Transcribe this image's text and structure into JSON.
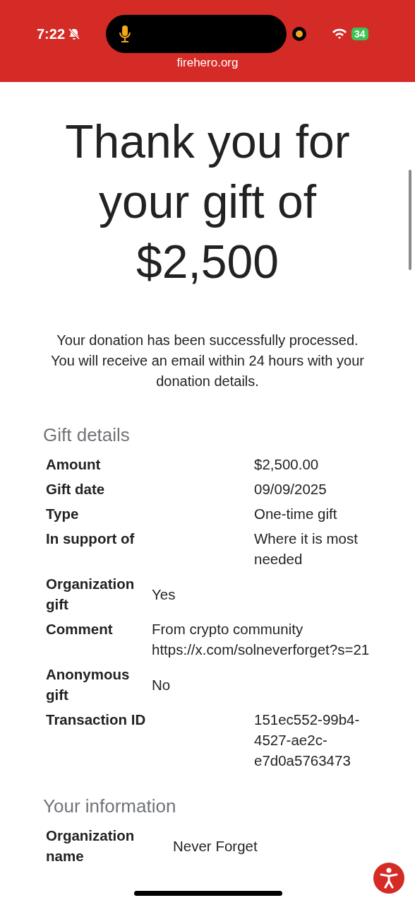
{
  "status_bar": {
    "time": "7:22",
    "battery": "34",
    "url": "firehero.org"
  },
  "heading": "Thank you for your gift of $2,500",
  "message": "Your donation has been successfully processed. You will receive an email within 24 hours with your donation details.",
  "sections": [
    {
      "title": "Gift details",
      "rows": [
        {
          "kind": "wide",
          "label": "Amount",
          "value": "$2,500.00"
        },
        {
          "kind": "wide",
          "label": "Gift date",
          "value": "09/09/2025"
        },
        {
          "kind": "wide",
          "label": "Type",
          "value": "One-time gift"
        },
        {
          "kind": "wide",
          "label": "In support of",
          "value": "Where it is most needed"
        },
        {
          "kind": "tight",
          "label": "Organization gift",
          "value": "Yes"
        },
        {
          "kind": "tight",
          "label": "Comment",
          "value": "From crypto community https://x.com/solneverforget?s=21"
        },
        {
          "kind": "tight",
          "label": "Anonymous gift",
          "value": "No"
        },
        {
          "kind": "wide",
          "label": "Transaction ID",
          "value": "151ec552-99b4-4527-ae2c-e7d0a5763473"
        }
      ]
    },
    {
      "title": "Your information",
      "rows": [
        {
          "kind": "mid",
          "label": "Organization name",
          "value": "Never Forget"
        }
      ]
    }
  ]
}
